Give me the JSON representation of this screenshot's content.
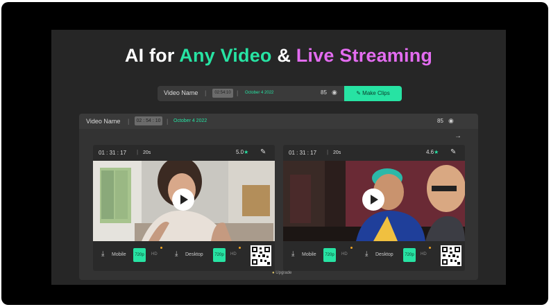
{
  "headline": {
    "part1": "AI for ",
    "part2": "Any Video",
    "part3": " & ",
    "part4": "Live Streaming"
  },
  "topbar": {
    "video_name": "Video Name",
    "timecode": "02:54:10",
    "date": "October 4 2022",
    "count": "85",
    "button": "Make Clips"
  },
  "panel": {
    "video_name": "Video Name",
    "timecode": "02 : 54 : 10",
    "date": "October 4 2022",
    "count": "85",
    "cards": [
      {
        "time": "01 : 31 : 17",
        "duration": "20s",
        "rating": "5.0",
        "mobile": "Mobile",
        "desktop": "Desktop",
        "q1": "720p",
        "q2": "HD"
      },
      {
        "time": "01 : 31 : 17",
        "duration": "20s",
        "rating": "4.6",
        "mobile": "Mobile",
        "desktop": "Desktop",
        "q1": "720p",
        "q2": "HD"
      }
    ],
    "upgrade": "Upgrade"
  },
  "icons": [
    "eye-icon",
    "clip-icon",
    "edit-icon",
    "play-icon",
    "download-icon",
    "qr-code",
    "expand-icon",
    "star-icon"
  ],
  "colors": {
    "accent": "#27e3a3",
    "pink": "#e36cf0",
    "background": "#262626"
  }
}
